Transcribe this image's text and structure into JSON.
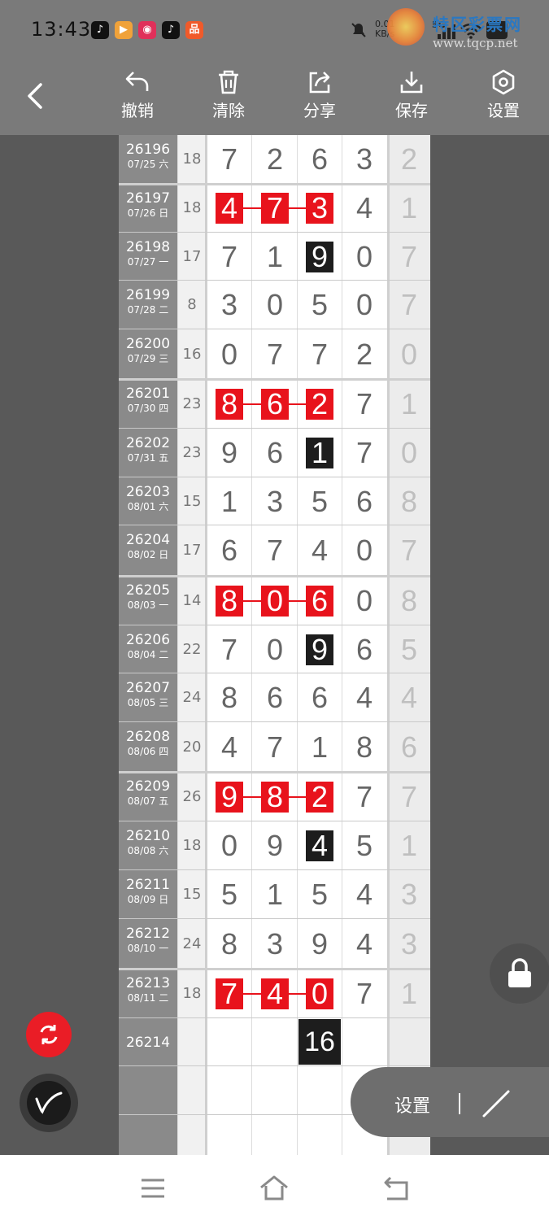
{
  "status": {
    "time": "13:43",
    "net_speed": "0.01\nKB/s",
    "network": "5G"
  },
  "watermark": {
    "brand": "特区彩票网",
    "url": "www.tqcp.net"
  },
  "toolbar": {
    "undo_label": "撤销",
    "clear_label": "清除",
    "share_label": "分享",
    "save_label": "保存",
    "settings_label": "设置"
  },
  "rows": [
    {
      "issue": "26196",
      "date": "07/25 六",
      "sum": "18",
      "digits": [
        "7",
        "2",
        "6",
        "3"
      ],
      "last": "2",
      "marks": []
    },
    {
      "issue": "26197",
      "date": "07/26 日",
      "sum": "18",
      "digits": [
        "4",
        "7",
        "3",
        "4"
      ],
      "last": "1",
      "marks": [
        "red",
        "red",
        "red",
        ""
      ]
    },
    {
      "issue": "26198",
      "date": "07/27 一",
      "sum": "17",
      "digits": [
        "7",
        "1",
        "9",
        "0"
      ],
      "last": "7",
      "marks": [
        "",
        "",
        "blk",
        ""
      ]
    },
    {
      "issue": "26199",
      "date": "07/28 二",
      "sum": "8",
      "digits": [
        "3",
        "0",
        "5",
        "0"
      ],
      "last": "7",
      "marks": []
    },
    {
      "issue": "26200",
      "date": "07/29 三",
      "sum": "16",
      "digits": [
        "0",
        "7",
        "7",
        "2"
      ],
      "last": "0",
      "marks": []
    },
    {
      "issue": "26201",
      "date": "07/30 四",
      "sum": "23",
      "digits": [
        "8",
        "6",
        "2",
        "7"
      ],
      "last": "1",
      "marks": [
        "red",
        "red",
        "red",
        ""
      ]
    },
    {
      "issue": "26202",
      "date": "07/31 五",
      "sum": "23",
      "digits": [
        "9",
        "6",
        "1",
        "7"
      ],
      "last": "0",
      "marks": [
        "",
        "",
        "blk",
        ""
      ]
    },
    {
      "issue": "26203",
      "date": "08/01 六",
      "sum": "15",
      "digits": [
        "1",
        "3",
        "5",
        "6"
      ],
      "last": "8",
      "marks": []
    },
    {
      "issue": "26204",
      "date": "08/02 日",
      "sum": "17",
      "digits": [
        "6",
        "7",
        "4",
        "0"
      ],
      "last": "7",
      "marks": []
    },
    {
      "issue": "26205",
      "date": "08/03 一",
      "sum": "14",
      "digits": [
        "8",
        "0",
        "6",
        "0"
      ],
      "last": "8",
      "marks": [
        "red",
        "red",
        "red",
        ""
      ]
    },
    {
      "issue": "26206",
      "date": "08/04 二",
      "sum": "22",
      "digits": [
        "7",
        "0",
        "9",
        "6"
      ],
      "last": "5",
      "marks": [
        "",
        "",
        "blk",
        ""
      ]
    },
    {
      "issue": "26207",
      "date": "08/05 三",
      "sum": "24",
      "digits": [
        "8",
        "6",
        "6",
        "4"
      ],
      "last": "4",
      "marks": []
    },
    {
      "issue": "26208",
      "date": "08/06 四",
      "sum": "20",
      "digits": [
        "4",
        "7",
        "1",
        "8"
      ],
      "last": "6",
      "marks": []
    },
    {
      "issue": "26209",
      "date": "08/07 五",
      "sum": "26",
      "digits": [
        "9",
        "8",
        "2",
        "7"
      ],
      "last": "7",
      "marks": [
        "red",
        "red",
        "red",
        ""
      ]
    },
    {
      "issue": "26210",
      "date": "08/08 六",
      "sum": "18",
      "digits": [
        "0",
        "9",
        "4",
        "5"
      ],
      "last": "1",
      "marks": [
        "",
        "",
        "blk",
        ""
      ]
    },
    {
      "issue": "26211",
      "date": "08/09 日",
      "sum": "15",
      "digits": [
        "5",
        "1",
        "5",
        "4"
      ],
      "last": "3",
      "marks": []
    },
    {
      "issue": "26212",
      "date": "08/10 一",
      "sum": "24",
      "digits": [
        "8",
        "3",
        "9",
        "4"
      ],
      "last": "3",
      "marks": []
    },
    {
      "issue": "26213",
      "date": "08/11 二",
      "sum": "18",
      "digits": [
        "7",
        "4",
        "0",
        "7"
      ],
      "last": "1",
      "marks": [
        "red",
        "red",
        "red",
        ""
      ]
    },
    {
      "issue": "26214",
      "date": "",
      "sum": "",
      "digits": [
        "",
        "",
        "",
        ""
      ],
      "last": "",
      "marks": []
    }
  ],
  "prediction": "16",
  "pill": {
    "label": "设置"
  }
}
